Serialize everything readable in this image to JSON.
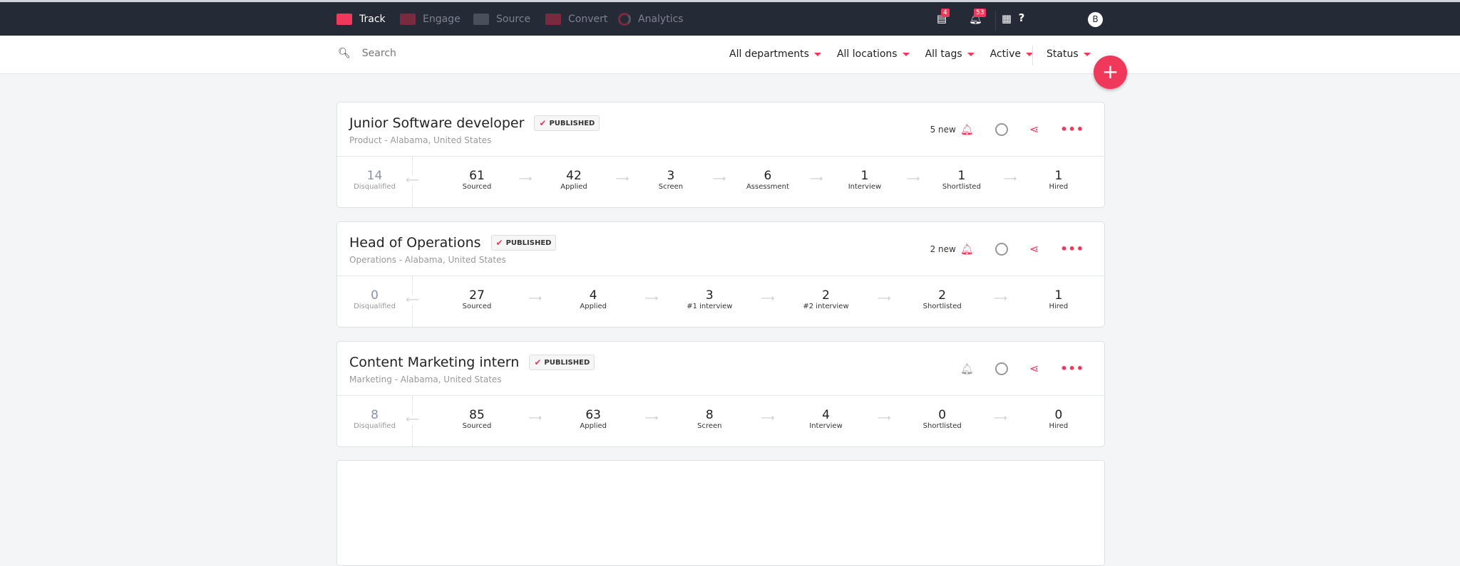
{
  "nav": {
    "items": [
      {
        "label": "Track",
        "icon": "track-icon",
        "active": true
      },
      {
        "label": "Engage",
        "icon": "engage-icon"
      },
      {
        "label": "Source",
        "icon": "source-icon"
      },
      {
        "label": "Convert",
        "icon": "convert-icon"
      },
      {
        "label": "Analytics",
        "icon": "analytics-icon"
      }
    ],
    "tasks_badge": "4",
    "notifications_badge": "53",
    "avatar": "B"
  },
  "search": {
    "placeholder": "Search"
  },
  "filters": [
    "All departments",
    "All locations",
    "All tags",
    "Active"
  ],
  "status_filter": "Status",
  "fab": "+",
  "accent": "#f0385a",
  "jobs": [
    {
      "title": "Junior Software developer",
      "badge": "PUBLISHED",
      "subtitle": "Product - Alabama, United States",
      "new": "5 new",
      "disqualified": {
        "count": "14",
        "label": "Disqualified"
      },
      "stages": [
        {
          "n": "61",
          "l": "Sourced"
        },
        {
          "n": "42",
          "l": "Applied"
        },
        {
          "n": "3",
          "l": "Screen"
        },
        {
          "n": "6",
          "l": "Assessment"
        },
        {
          "n": "1",
          "l": "Interview"
        },
        {
          "n": "1",
          "l": "Shortlisted"
        },
        {
          "n": "1",
          "l": "Hired"
        }
      ]
    },
    {
      "title": "Head of Operations",
      "badge": "PUBLISHED",
      "subtitle": "Operations - Alabama, United States",
      "new": "2 new",
      "disqualified": {
        "count": "0",
        "label": "Disqualified"
      },
      "stages": [
        {
          "n": "27",
          "l": "Sourced"
        },
        {
          "n": "4",
          "l": "Applied"
        },
        {
          "n": "3",
          "l": "#1 interview"
        },
        {
          "n": "2",
          "l": "#2 interview"
        },
        {
          "n": "2",
          "l": "Shortlisted"
        },
        {
          "n": "1",
          "l": "Hired"
        }
      ]
    },
    {
      "title": "Content Marketing intern",
      "badge": "PUBLISHED",
      "subtitle": "Marketing - Alabama, United States",
      "new": "",
      "disqualified": {
        "count": "8",
        "label": "Disqualified"
      },
      "stages": [
        {
          "n": "85",
          "l": "Sourced"
        },
        {
          "n": "63",
          "l": "Applied"
        },
        {
          "n": "8",
          "l": "Screen"
        },
        {
          "n": "4",
          "l": "Interview"
        },
        {
          "n": "0",
          "l": "Shortlisted"
        },
        {
          "n": "0",
          "l": "Hired"
        }
      ]
    }
  ]
}
